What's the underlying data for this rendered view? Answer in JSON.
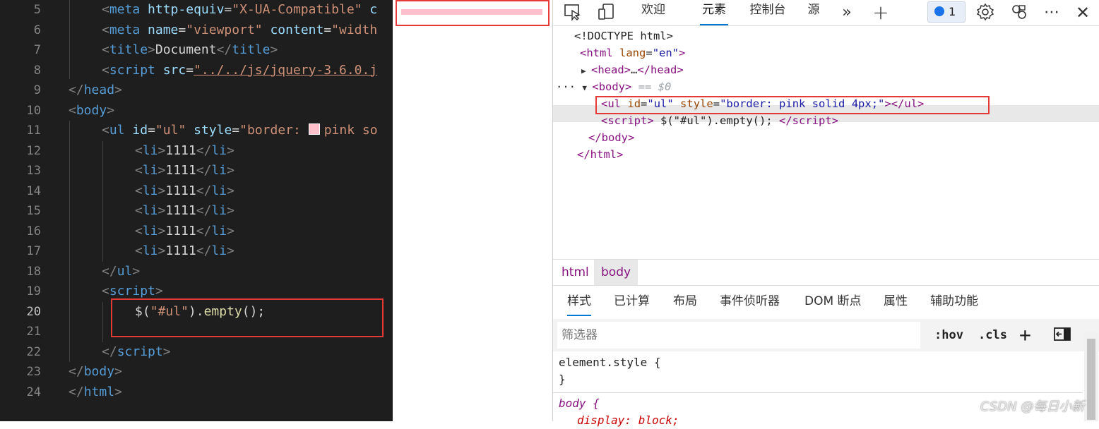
{
  "editor": {
    "lines": [
      {
        "no": "5",
        "indent": 1,
        "segs": [
          [
            "br",
            "<"
          ],
          [
            "tag",
            "meta"
          ],
          [
            "txt",
            " "
          ],
          [
            "attr",
            "http-equiv"
          ],
          [
            "txt",
            "="
          ],
          [
            "str",
            "\"X-UA-Compatible\""
          ],
          [
            "txt",
            " "
          ],
          [
            "attr",
            "c"
          ]
        ]
      },
      {
        "no": "6",
        "indent": 1,
        "segs": [
          [
            "br",
            "<"
          ],
          [
            "tag",
            "meta"
          ],
          [
            "txt",
            " "
          ],
          [
            "attr",
            "name"
          ],
          [
            "txt",
            "="
          ],
          [
            "str",
            "\"viewport\""
          ],
          [
            "txt",
            " "
          ],
          [
            "attr",
            "content"
          ],
          [
            "txt",
            "="
          ],
          [
            "str",
            "\"width"
          ]
        ]
      },
      {
        "no": "7",
        "indent": 1,
        "segs": [
          [
            "br",
            "<"
          ],
          [
            "tag",
            "title"
          ],
          [
            "br",
            ">"
          ],
          [
            "txt",
            "Document"
          ],
          [
            "br",
            "</"
          ],
          [
            "tag",
            "title"
          ],
          [
            "br",
            ">"
          ]
        ]
      },
      {
        "no": "8",
        "indent": 1,
        "segs": [
          [
            "br",
            "<"
          ],
          [
            "tag",
            "script"
          ],
          [
            "txt",
            " "
          ],
          [
            "attr",
            "src"
          ],
          [
            "txt",
            "="
          ],
          [
            "link",
            "\"../../js/jquery-3.6.0.j"
          ]
        ]
      },
      {
        "no": "9",
        "indent": 0,
        "segs": [
          [
            "br",
            "</"
          ],
          [
            "tag",
            "head"
          ],
          [
            "br",
            ">"
          ]
        ]
      },
      {
        "no": "10",
        "indent": 0,
        "segs": [
          [
            "br",
            "<"
          ],
          [
            "tag",
            "body"
          ],
          [
            "br",
            ">"
          ]
        ]
      },
      {
        "no": "11",
        "indent": 1,
        "segs": [
          [
            "br",
            "<"
          ],
          [
            "tag",
            "ul"
          ],
          [
            "txt",
            " "
          ],
          [
            "attr",
            "id"
          ],
          [
            "txt",
            "="
          ],
          [
            "str",
            "\"ul\""
          ],
          [
            "txt",
            " "
          ],
          [
            "attr",
            "style"
          ],
          [
            "txt",
            "="
          ],
          [
            "str",
            "\"border: "
          ],
          [
            "swatch",
            ""
          ],
          [
            "str",
            "pink so"
          ]
        ]
      },
      {
        "no": "12",
        "indent": 2,
        "segs": [
          [
            "br",
            "<"
          ],
          [
            "tag",
            "li"
          ],
          [
            "br",
            ">"
          ],
          [
            "txt",
            "1111"
          ],
          [
            "br",
            "</"
          ],
          [
            "tag",
            "li"
          ],
          [
            "br",
            ">"
          ]
        ]
      },
      {
        "no": "13",
        "indent": 2,
        "segs": [
          [
            "br",
            "<"
          ],
          [
            "tag",
            "li"
          ],
          [
            "br",
            ">"
          ],
          [
            "txt",
            "1111"
          ],
          [
            "br",
            "</"
          ],
          [
            "tag",
            "li"
          ],
          [
            "br",
            ">"
          ]
        ]
      },
      {
        "no": "14",
        "indent": 2,
        "segs": [
          [
            "br",
            "<"
          ],
          [
            "tag",
            "li"
          ],
          [
            "br",
            ">"
          ],
          [
            "txt",
            "1111"
          ],
          [
            "br",
            "</"
          ],
          [
            "tag",
            "li"
          ],
          [
            "br",
            ">"
          ]
        ]
      },
      {
        "no": "15",
        "indent": 2,
        "segs": [
          [
            "br",
            "<"
          ],
          [
            "tag",
            "li"
          ],
          [
            "br",
            ">"
          ],
          [
            "txt",
            "1111"
          ],
          [
            "br",
            "</"
          ],
          [
            "tag",
            "li"
          ],
          [
            "br",
            ">"
          ]
        ]
      },
      {
        "no": "16",
        "indent": 2,
        "segs": [
          [
            "br",
            "<"
          ],
          [
            "tag",
            "li"
          ],
          [
            "br",
            ">"
          ],
          [
            "txt",
            "1111"
          ],
          [
            "br",
            "</"
          ],
          [
            "tag",
            "li"
          ],
          [
            "br",
            ">"
          ]
        ]
      },
      {
        "no": "17",
        "indent": 2,
        "segs": [
          [
            "br",
            "<"
          ],
          [
            "tag",
            "li"
          ],
          [
            "br",
            ">"
          ],
          [
            "txt",
            "1111"
          ],
          [
            "br",
            "</"
          ],
          [
            "tag",
            "li"
          ],
          [
            "br",
            ">"
          ]
        ]
      },
      {
        "no": "18",
        "indent": 1,
        "segs": [
          [
            "br",
            "</"
          ],
          [
            "tag",
            "ul"
          ],
          [
            "br",
            ">"
          ]
        ]
      },
      {
        "no": "19",
        "indent": 1,
        "segs": [
          [
            "br",
            "<"
          ],
          [
            "tag",
            "script"
          ],
          [
            "br",
            ">"
          ]
        ]
      },
      {
        "no": "20",
        "indent": 2,
        "current": true,
        "segs": [
          [
            "txt",
            "$("
          ],
          [
            "str",
            "\"#ul\""
          ],
          [
            "txt",
            ")."
          ],
          [
            "fn",
            "empty"
          ],
          [
            "txt",
            "();"
          ]
        ]
      },
      {
        "no": "21",
        "indent": 0,
        "segs": []
      },
      {
        "no": "22",
        "indent": 1,
        "segs": [
          [
            "br",
            "</"
          ],
          [
            "tag",
            "script"
          ],
          [
            "br",
            ">"
          ]
        ]
      },
      {
        "no": "23",
        "indent": 0,
        "segs": [
          [
            "br",
            "</"
          ],
          [
            "tag",
            "body"
          ],
          [
            "br",
            ">"
          ]
        ]
      },
      {
        "no": "24",
        "indent": 0,
        "segs": [
          [
            "br",
            "</"
          ],
          [
            "tag",
            "html"
          ],
          [
            "br",
            ">"
          ]
        ]
      }
    ]
  },
  "devtools": {
    "toolbar": {
      "tabs": {
        "welcome": "欢迎",
        "elements": "元素",
        "console": "控制台",
        "sources": "源"
      },
      "message_count": "1"
    },
    "dom": {
      "doctype": "<!DOCTYPE html>",
      "html_open": {
        "tag": "html",
        "attr": "lang",
        "val": "\"en\""
      },
      "head_collapsed": "…",
      "body_tag": "body",
      "body_hint": "== $0",
      "ul_line": {
        "tag": "ul",
        "a1": "id",
        "v1": "\"ul\"",
        "a2": "style",
        "v2": "\"border: pink solid 4px;\""
      },
      "script_line": {
        "tag": "script",
        "content": " $(\"#ul\").empty(); "
      },
      "ellipsis": "···"
    },
    "breadcrumbs": [
      "html",
      "body"
    ],
    "sub_tabs": [
      "样式",
      "已计算",
      "布局",
      "事件侦听器",
      "DOM 断点",
      "属性",
      "辅助功能"
    ],
    "filter": {
      "placeholder": "筛选器",
      "hov": ":hov",
      "cls": ".cls"
    },
    "styles": {
      "element_style_open": "element.style {",
      "close": "}",
      "body_rule": "body {",
      "body_decl": "display: block;"
    }
  },
  "watermark": "CSDN @每日小新"
}
